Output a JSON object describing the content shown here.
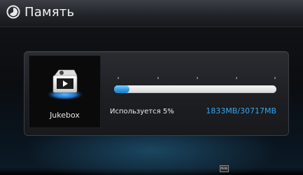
{
  "header": {
    "title": "Память",
    "icon": "pie-chart-icon"
  },
  "app": {
    "label": "Jukebox",
    "icon": "jukebox-media-icon"
  },
  "storage": {
    "used_label": "Используется 5%",
    "used_percent": 5,
    "size_label": "1833MB/30717MB"
  },
  "footer": {
    "key_label": "MENU"
  },
  "colors": {
    "accent": "#36a5ef",
    "progress_fill": "#2f9ee6",
    "progress_track": "#e8e8e8"
  }
}
